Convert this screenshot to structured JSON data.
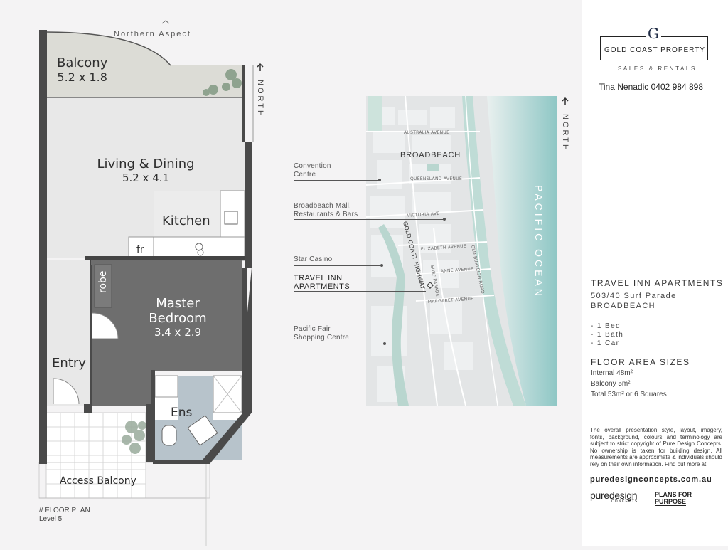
{
  "plan": {
    "aspect": "Northern Aspect",
    "north": "NORTH",
    "rooms": {
      "balcony": {
        "name": "Balcony",
        "dims": "5.2 x 1.8"
      },
      "living": {
        "name": "Living & Dining",
        "dims": "5.2 x 4.1"
      },
      "kitchen": {
        "name": "Kitchen"
      },
      "fridge": "fr",
      "robe": "robe",
      "master": {
        "name": "Master",
        "name2": "Bedroom",
        "dims": "3.4 x 2.9"
      },
      "entry": "Entry",
      "ensuite": "Ens",
      "access": "Access Balcony"
    },
    "caption1": "// FLOOR PLAN",
    "caption2": "Level 5"
  },
  "map": {
    "north": "NORTH",
    "suburb": "BROADBEACH",
    "ocean": "PACIFIC OCEAN",
    "highway": "GOLD COAST HIGHWAY",
    "streets": {
      "australia": "AUSTRALIA AVENUE",
      "queensland": "QUEENSLAND AVENUE",
      "victoria": "VICTORIA AVE",
      "elizabeth": "ELIZABETH AVENUE",
      "anne": "ANNE AVENUE",
      "margaret": "MARGARET AVENUE",
      "surf": "SURF PARADE",
      "burleigh": "OLD BURLEIGH ROAD"
    },
    "callouts": {
      "convention1": "Convention",
      "convention2": "Centre",
      "mall1": "Broadbeach Mall,",
      "mall2": "Restaurants & Bars",
      "casino": "Star Casino",
      "travel1": "TRAVEL INN",
      "travel2": "APARTMENTS",
      "fair1": "Pacific Fair",
      "fair2": "Shopping Centre"
    }
  },
  "panel": {
    "logo_letter": "G",
    "logo_title": "GOLD COAST PROPERTY",
    "logo_sub": "SALES & RENTALS",
    "agent": "Tina Nenadic  0402 984 898",
    "property_name": "TRAVEL INN APARTMENTS",
    "address1": "503/40 Surf Parade",
    "address2": "BROADBEACH",
    "features": [
      "- 1 Bed",
      "- 1 Bath",
      "- 1 Car"
    ],
    "area_title": "FLOOR AREA SIZES",
    "areas": [
      "Internal 48m²",
      "Balcony 5m²",
      "Total 53m² or 6 Squares"
    ],
    "disclaimer": "The overall presentation style, layout, imagery, fonts, background, colours and terminology are subject to strict copyright of Pure Design Concepts. No ownership is taken for building design. All measurements are approximate & individuals should rely on their own information. Find out more at:",
    "website": "puredesignconcepts.com.au",
    "brand1": "puredesign",
    "brand1_sub": "CONCEPTS",
    "brand2a": "PLANS FOR",
    "brand2b": "PURPOSE"
  }
}
